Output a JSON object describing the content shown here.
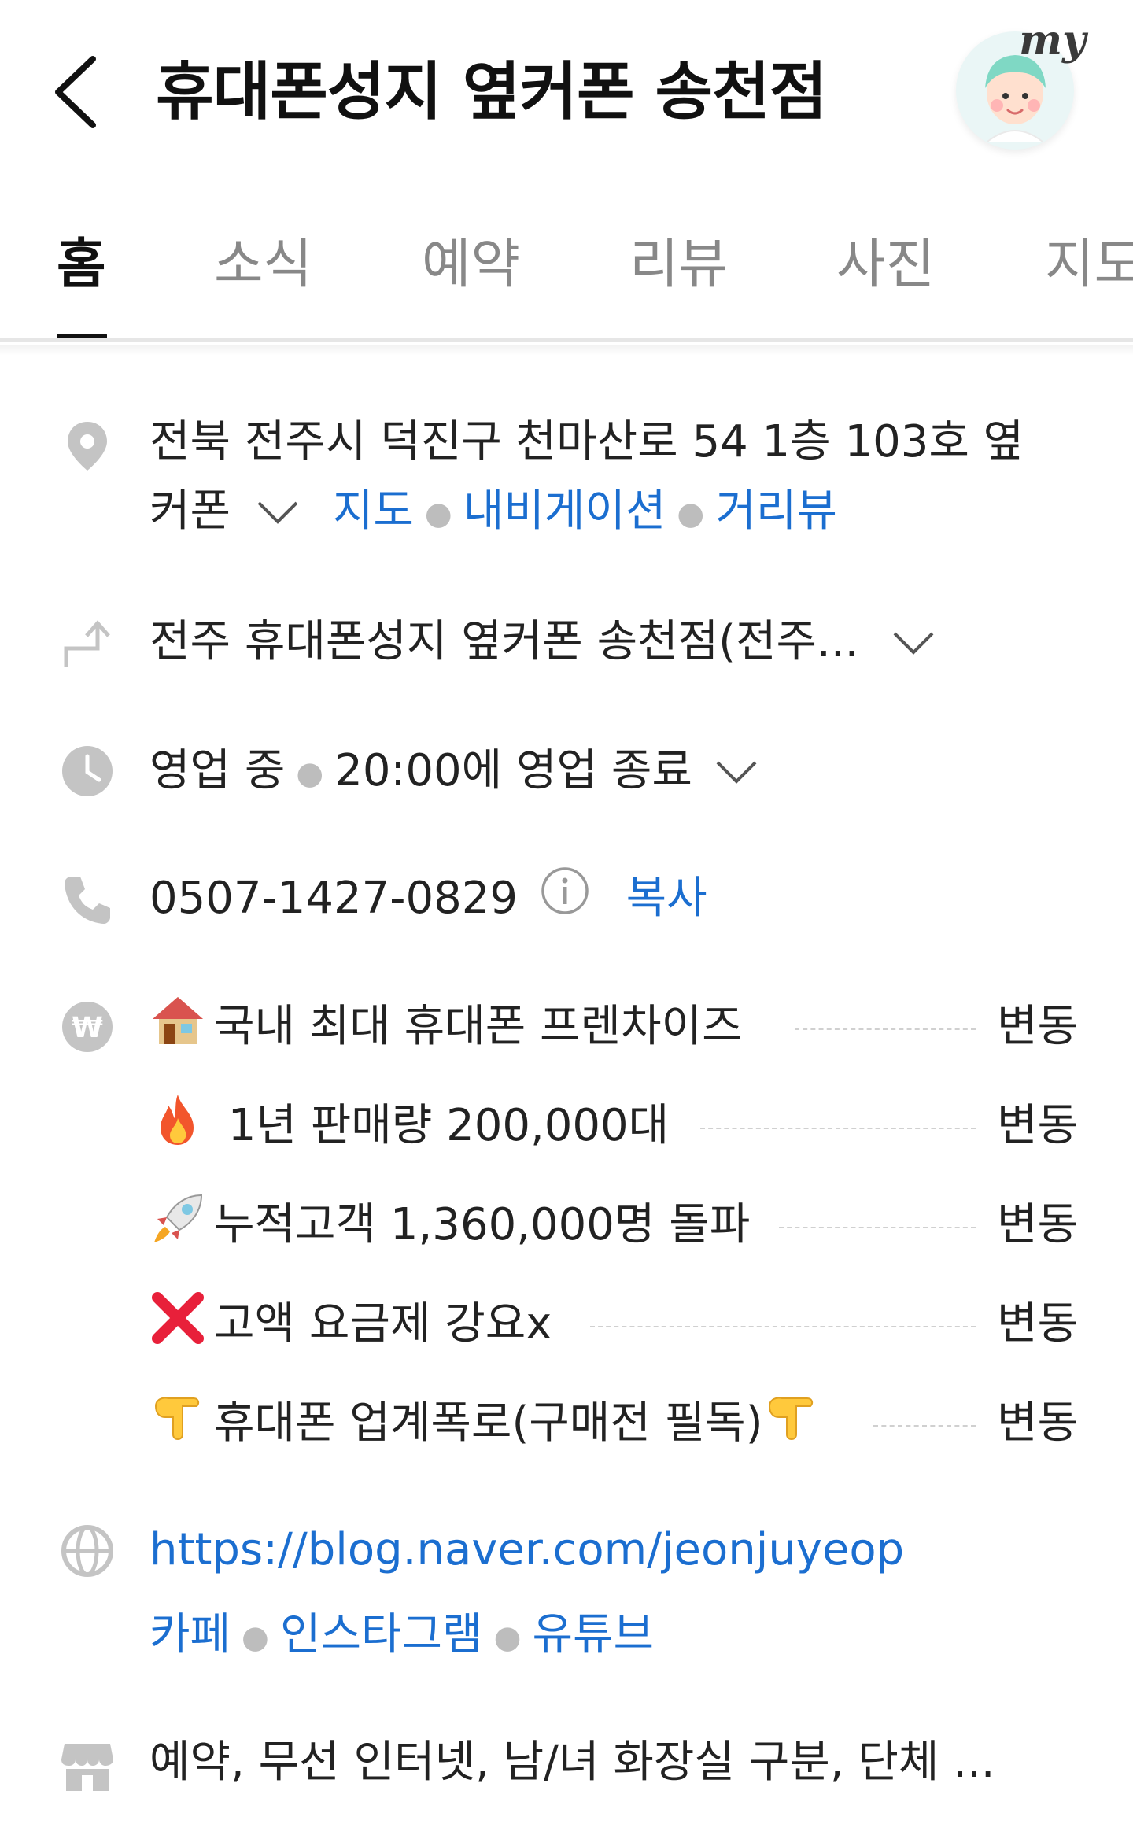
{
  "header": {
    "title": "휴대폰성지 옆커폰 송천점",
    "my_badge": "my"
  },
  "tabs": [
    {
      "label": "홈",
      "active": true
    },
    {
      "label": "소식",
      "active": false
    },
    {
      "label": "예약",
      "active": false
    },
    {
      "label": "리뷰",
      "active": false
    },
    {
      "label": "사진",
      "active": false
    },
    {
      "label": "지도",
      "active": false
    }
  ],
  "address": {
    "line1": "전북 전주시 덕진구 천마산로 54 1층 103호 옆",
    "line2": "커폰",
    "links": [
      "지도",
      "내비게이션",
      "거리뷰"
    ]
  },
  "directions": {
    "text": "전주 휴대폰성지 옆커폰 송천점(전주..."
  },
  "hours": {
    "status": "영업 중",
    "detail": "20:00에 영업 종료"
  },
  "phone": {
    "number": "0507-1427-0829",
    "copy_label": "복사"
  },
  "prices": [
    {
      "emoji": "house-emoji",
      "name": "국내 최대 휴대폰 프렌차이즈",
      "value": "변동"
    },
    {
      "emoji": "fire-emoji",
      "name": " 1년 판매량 200,000대",
      "value": "변동"
    },
    {
      "emoji": "rocket-emoji",
      "name": "누적고객 1,360,000명 돌파",
      "value": "변동"
    },
    {
      "emoji": "cross-mark-emoji",
      "name": "고액 요금제 강요x",
      "value": "변동"
    },
    {
      "emoji": "pointing-down-emoji",
      "name": "휴대폰 업계폭로(구매전 필독)",
      "value": "변동"
    }
  ],
  "website": {
    "url": "https://blog.naver.com/jeonjuyeop",
    "sns": [
      "카페",
      "인스타그램",
      "유튜브"
    ]
  },
  "amenities": {
    "text": "예약, 무선 인터넷, 남/녀 화장실 구분, 단체 ..."
  },
  "colors": {
    "link": "#1b6ed0",
    "icon_gray": "#c4c4c4",
    "text": "#222222"
  }
}
